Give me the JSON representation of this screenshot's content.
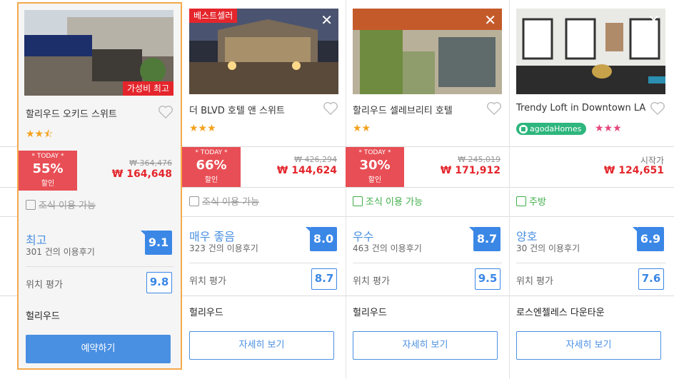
{
  "cards": [
    {
      "name": "할리우드 오키드 스위트",
      "image_tag": "가성비 최고",
      "stars": "★★⯪",
      "today_label": "* TODAY *",
      "discount": "55%",
      "discount_label": "할인",
      "original_price": "₩ 364,476",
      "price": "₩ 164,648",
      "amenity": "조식 이용 가능",
      "rating_word": "최고",
      "review_count": "301 건의 이용후기",
      "score": "9.1",
      "location_label": "위치 평가",
      "location_score": "9.8",
      "area": "헐리우드",
      "button": "예약하기"
    },
    {
      "name": "더 BLVD 호텔 앤 스위트",
      "image_tag": "베스트셀러",
      "close_icon": "✕",
      "stars": "★★★",
      "today_label": "* TODAY *",
      "discount": "66%",
      "discount_label": "할인",
      "original_price": "₩ 426,294",
      "price": "₩ 144,624",
      "amenity": "조식 이용 가능",
      "rating_word": "매우 좋음",
      "review_count": "323 건의 이용후기",
      "score": "8.0",
      "location_label": "위치 평가",
      "location_score": "8.7",
      "area": "헐리우드",
      "button": "자세히 보기"
    },
    {
      "name": "할리우드 셀레브리티 호텔",
      "close_icon": "✕",
      "stars": "★★",
      "today_label": "* TODAY *",
      "discount": "30%",
      "discount_label": "할인",
      "original_price": "₩ 245,019",
      "price": "₩ 171,912",
      "amenity": "조식 이용 가능",
      "rating_word": "우수",
      "review_count": "463 건의 이용후기",
      "score": "8.7",
      "location_label": "위치 평가",
      "location_score": "9.5",
      "area": "헐리우드",
      "button": "자세히 보기"
    },
    {
      "name": "Trendy Loft in Downtown LA",
      "close_icon": "✕",
      "agoda_badge": "agodaHomes",
      "stars": "★★★",
      "from_label": "시작가",
      "price": "₩ 124,651",
      "amenity": "주방",
      "rating_word": "양호",
      "review_count": "30 건의 이용후기",
      "score": "6.9",
      "location_label": "위치 평가",
      "location_score": "7.6",
      "area": "로스엔젤레스 다운타운",
      "button": "자세히 보기"
    }
  ],
  "colors": {
    "accent_blue": "#4a90e2",
    "discount_red": "#e84e55",
    "selected_border": "#f6a94a",
    "amenity_green": "#3fae49"
  }
}
